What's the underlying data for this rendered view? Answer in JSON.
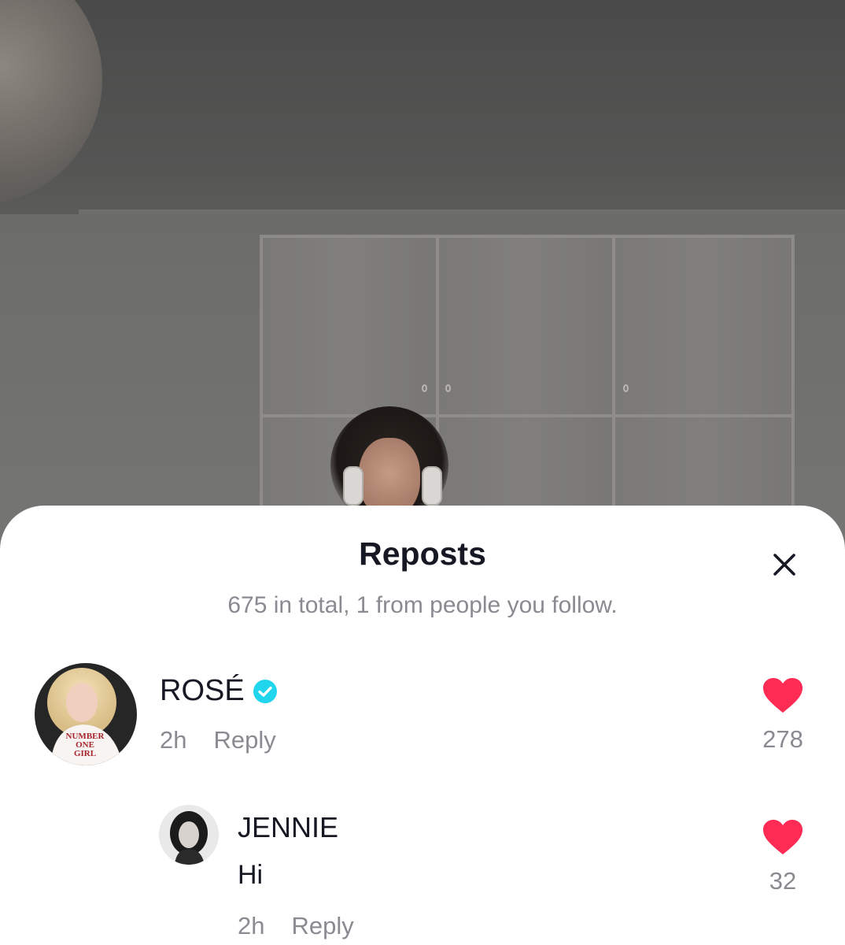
{
  "sheet": {
    "title": "Reposts",
    "subtitle": "675 in total, 1 from people you follow."
  },
  "comments": [
    {
      "username": "ROSÉ",
      "verified": true,
      "avatar_shirt_text": "NUMBER ONE GIRL",
      "time": "2h",
      "reply_label": "Reply",
      "likes": "278"
    },
    {
      "username": "JENNIE",
      "text": "Hi",
      "time": "2h",
      "reply_label": "Reply",
      "likes": "32"
    }
  ],
  "colors": {
    "heart": "#fe2c55",
    "verified": "#20d5ec",
    "primary_text": "#161823",
    "secondary_text": "#8a8b91"
  },
  "icons": [
    "close-icon",
    "verified-badge-icon",
    "heart-icon"
  ]
}
